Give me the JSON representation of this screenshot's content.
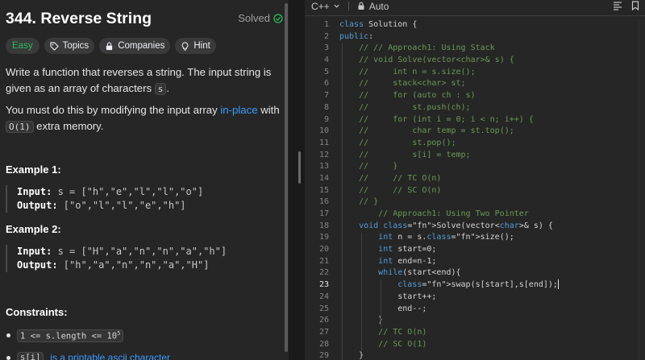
{
  "problem": {
    "title": "344. Reverse String",
    "status": "Solved",
    "tags": [
      {
        "label": "Easy"
      },
      {
        "label": "Topics"
      },
      {
        "label": "Companies"
      },
      {
        "label": "Hint"
      }
    ],
    "desc1_a": "Write a function that reverses a string. The input string is given as an array of characters ",
    "desc1_code": "s",
    "desc1_b": ".",
    "desc2_a": "You must do this by modifying the input array ",
    "desc2_link": "in-place",
    "desc2_b": " with ",
    "desc2_code": "O(1)",
    "desc2_c": " extra memory.",
    "example1": {
      "title": "Example 1:",
      "input_label": "Input:",
      "input_value": " s = [\"h\",\"e\",\"l\",\"l\",\"o\"]",
      "output_label": "Output:",
      "output_value": " [\"o\",\"l\",\"l\",\"e\",\"h\"]"
    },
    "example2": {
      "title": "Example 2:",
      "input_label": "Input:",
      "input_value": " s = [\"H\",\"a\",\"n\",\"n\",\"a\",\"h\"]",
      "output_label": "Output:",
      "output_value": " [\"h\",\"a\",\"n\",\"n\",\"a\",\"H\"]"
    },
    "constraints_title": "Constraints:",
    "constraint1": "1 <= s.length <= 10",
    "constraint1_sup": "5",
    "constraint2_code": "s[i]",
    "constraint2_text": "is a printable ascii character"
  },
  "editor": {
    "language": "C++",
    "mode": "Auto",
    "active_line": 23,
    "lines": [
      {
        "n": "1",
        "code": "class Solution {"
      },
      {
        "n": "2",
        "code": "public:"
      },
      {
        "n": "3",
        "code": "    // // Approach1: Using Stack"
      },
      {
        "n": "4",
        "code": "    // void Solve(vector<char>& s) {"
      },
      {
        "n": "5",
        "code": "    //     int n = s.size();"
      },
      {
        "n": "6",
        "code": "    //     stack<char> st;"
      },
      {
        "n": "7",
        "code": "    //     for (auto ch : s)"
      },
      {
        "n": "8",
        "code": "    //         st.push(ch);"
      },
      {
        "n": "9",
        "code": "    //     for (int i = 0; i < n; i++) {"
      },
      {
        "n": "10",
        "code": "    //         char temp = st.top();"
      },
      {
        "n": "11",
        "code": "    //         st.pop();"
      },
      {
        "n": "12",
        "code": "    //         s[i] = temp;"
      },
      {
        "n": "13",
        "code": "    //     }"
      },
      {
        "n": "14",
        "code": "    //     // TC O(n)"
      },
      {
        "n": "15",
        "code": "    //     // SC O(n)"
      },
      {
        "n": "16",
        "code": "    // }"
      },
      {
        "n": "17",
        "code": "        // Approach1: Using Two Pointer"
      },
      {
        "n": "18",
        "code": "    void Solve(vector<char>& s) {"
      },
      {
        "n": "19",
        "code": "        int n = s.size();"
      },
      {
        "n": "20",
        "code": "        int start=0;"
      },
      {
        "n": "21",
        "code": "        int end=n-1;"
      },
      {
        "n": "22",
        "code": "        while(start<end){"
      },
      {
        "n": "23",
        "code": "            swap(s[start],s[end]);"
      },
      {
        "n": "24",
        "code": "            start++;"
      },
      {
        "n": "25",
        "code": "            end--;"
      },
      {
        "n": "26",
        "code": "        }"
      },
      {
        "n": "27",
        "code": "        // TC O(n)"
      },
      {
        "n": "28",
        "code": "        // SC O(1)"
      },
      {
        "n": "29",
        "code": "    }"
      }
    ]
  },
  "colors": {
    "easy": "#2cbb5d",
    "link": "#3b9cff",
    "keyword": "#569cd6",
    "comment": "#6a9955",
    "function": "#dcdcaa"
  }
}
